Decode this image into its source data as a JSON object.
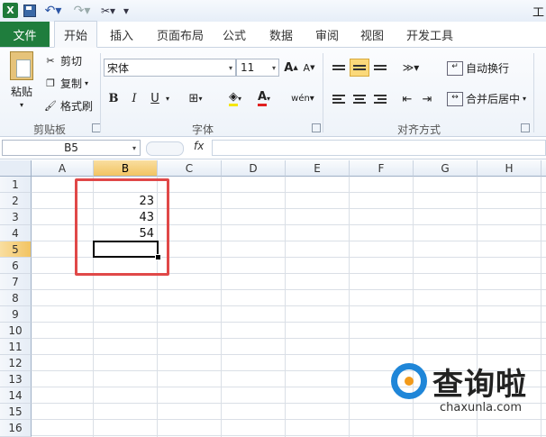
{
  "qat": {
    "logo": "X",
    "title_fragment": "工"
  },
  "tabs": {
    "file": "文件",
    "items": [
      "开始",
      "插入",
      "页面布局",
      "公式",
      "数据",
      "审阅",
      "视图",
      "开发工具"
    ]
  },
  "ribbon": {
    "clipboard": {
      "paste": "粘贴",
      "cut": "剪切",
      "copy": "复制",
      "format_painter": "格式刷",
      "group": "剪贴板"
    },
    "font": {
      "name": "宋体",
      "size": "11",
      "bold": "B",
      "italic": "I",
      "underline": "U",
      "group": "字体"
    },
    "alignment": {
      "wrap_text": "自动换行",
      "merge_center": "合并后居中",
      "group": "对齐方式"
    }
  },
  "formula_bar": {
    "name_box": "B5",
    "fx": "fx",
    "formula": ""
  },
  "sheet": {
    "columns": [
      "A",
      "B",
      "C",
      "D",
      "E",
      "F",
      "G",
      "H"
    ],
    "rows": [
      "1",
      "2",
      "3",
      "4",
      "5",
      "6",
      "7",
      "8",
      "9",
      "10",
      "11",
      "12",
      "13",
      "14",
      "15",
      "16"
    ],
    "cells": {
      "B2": "23",
      "B3": "43",
      "B4": "54"
    },
    "active_cell": "B5"
  },
  "watermark": {
    "brand": "查询啦",
    "domain": "chaxunla.com"
  },
  "colors": {
    "file_tab": "#1f7d3d",
    "highlight_box": "#e04848",
    "selected_header": "#f2c462"
  }
}
